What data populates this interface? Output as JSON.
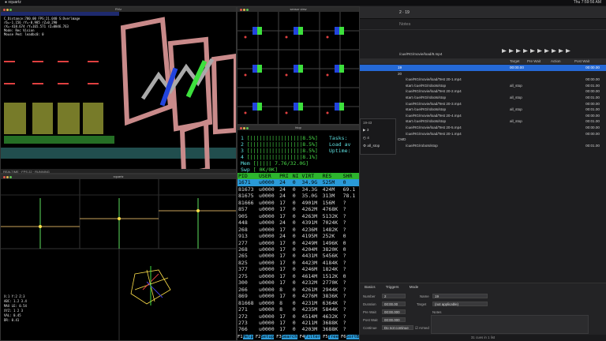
{
  "menubar": {
    "app": "xquartz",
    "clock": "Thu 7:59:56 AM"
  },
  "windows": {
    "topleft_title": "RViz",
    "topmid_title": "rviz_sim",
    "sensor_title": "sensor view",
    "bottomleft_title": "xquartz",
    "bottomleft_sub": "rviz",
    "htop_title": "htop"
  },
  "topleft_text": {
    "lines": [
      "C_Distance:780.00 FPS:21.040 S:Overlmage",
      "rb=-1.156 rY=-0.985 rZ=0.290",
      "rX=-418.674 rY=165.571 rZ=0846.763",
      "Mode: Rec Vision",
      "Mouse Ped: leadbc0: 0"
    ]
  },
  "htop": {
    "meters": [
      {
        "id": "1",
        "bar": "[|||||||||||||||||8.5%]",
        "right_label": "Tasks:"
      },
      {
        "id": "2",
        "bar": "[|||||||||||||||||8.5%]",
        "right_label": "Load av"
      },
      {
        "id": "3",
        "bar": "[|||||||||||||||||8.5%]",
        "right_label": "Uptime:"
      },
      {
        "id": "4",
        "bar": "[|||||||||||||||||8.1%]",
        "right_label": ""
      },
      {
        "id": "Mem",
        "bar": "[||||| 7.76/32.0G]",
        "right_label": ""
      },
      {
        "id": "Swp",
        "bar": "[ 0K/0K]",
        "right_label": ""
      }
    ],
    "columns": [
      "PID",
      "USER",
      "PRI",
      "NI",
      "VIRT",
      "RES",
      "SHR"
    ],
    "rows": [
      {
        "pid": "1671",
        "user": "u0000",
        "pri": "24",
        "ni": "0",
        "virt": "34.9G",
        "res": "525M",
        "shr": "0"
      },
      {
        "pid": "81673",
        "user": "u0000",
        "pri": "24",
        "ni": "0",
        "virt": "34.3G",
        "res": "424M",
        "shr": "69.1"
      },
      {
        "pid": "81675",
        "user": "u0000",
        "pri": "24",
        "ni": "0",
        "virt": "35.0G",
        "res": "313M",
        "shr": "78.1"
      },
      {
        "pid": "81666",
        "user": "u0000",
        "pri": "17",
        "ni": "0",
        "virt": "4901M",
        "res": "156M",
        "shr": "?"
      },
      {
        "pid": "857",
        "user": "u0000",
        "pri": "17",
        "ni": "0",
        "virt": "4262M",
        "res": "4768K",
        "shr": "?"
      },
      {
        "pid": "905",
        "user": "u0000",
        "pri": "17",
        "ni": "0",
        "virt": "4263M",
        "res": "5132K",
        "shr": "?"
      },
      {
        "pid": "448",
        "user": "u0000",
        "pri": "24",
        "ni": "0",
        "virt": "4391M",
        "res": "7024K",
        "shr": "?"
      },
      {
        "pid": "268",
        "user": "u0000",
        "pri": "17",
        "ni": "0",
        "virt": "4236M",
        "res": "1482K",
        "shr": "?"
      },
      {
        "pid": "913",
        "user": "u0000",
        "pri": "24",
        "ni": "0",
        "virt": "4195M",
        "res": "252K",
        "shr": "0"
      },
      {
        "pid": "277",
        "user": "u0000",
        "pri": "17",
        "ni": "0",
        "virt": "4249M",
        "res": "1496K",
        "shr": "0"
      },
      {
        "pid": "268",
        "user": "u0000",
        "pri": "17",
        "ni": "0",
        "virt": "4204M",
        "res": "3820K",
        "shr": "0"
      },
      {
        "pid": "265",
        "user": "u0000",
        "pri": "17",
        "ni": "0",
        "virt": "4431M",
        "res": "5456K",
        "shr": "?"
      },
      {
        "pid": "825",
        "user": "u0000",
        "pri": "17",
        "ni": "0",
        "virt": "4423M",
        "res": "4184K",
        "shr": "?"
      },
      {
        "pid": "377",
        "user": "u0000",
        "pri": "17",
        "ni": "0",
        "virt": "4246M",
        "res": "1824K",
        "shr": "?"
      },
      {
        "pid": "275",
        "user": "u0000",
        "pri": "17",
        "ni": "0",
        "virt": "4614M",
        "res": "1512K",
        "shr": "0"
      },
      {
        "pid": "300",
        "user": "u0000",
        "pri": "17",
        "ni": "0",
        "virt": "4232M",
        "res": "2770K",
        "shr": "?"
      },
      {
        "pid": "266",
        "user": "u0000",
        "pri": "8",
        "ni": "0",
        "virt": "4261M",
        "res": "2944K",
        "shr": "?"
      },
      {
        "pid": "869",
        "user": "u0000",
        "pri": "17",
        "ni": "0",
        "virt": "4276M",
        "res": "3836K",
        "shr": "?"
      },
      {
        "pid": "81668",
        "user": "u0000",
        "pri": "8",
        "ni": "0",
        "virt": "4231M",
        "res": "6364K",
        "shr": "?"
      },
      {
        "pid": "271",
        "user": "u0000",
        "pri": "8",
        "ni": "0",
        "virt": "4235M",
        "res": "5844K",
        "shr": "?"
      },
      {
        "pid": "272",
        "user": "u0000",
        "pri": "17",
        "ni": "0",
        "virt": "4514M",
        "res": "4632K",
        "shr": "?"
      },
      {
        "pid": "273",
        "user": "u0000",
        "pri": "17",
        "ni": "0",
        "virt": "4211M",
        "res": "3688K",
        "shr": "?"
      },
      {
        "pid": "766",
        "user": "u0000",
        "pri": "17",
        "ni": "0",
        "virt": "4203M",
        "res": "3688K",
        "shr": "?"
      },
      {
        "pid": "301",
        "user": "u0000",
        "pri": "24",
        "ni": "0",
        "virt": "4448M",
        "res": "5420K",
        "shr": "?"
      }
    ],
    "fkeys": [
      {
        "k": "F1",
        "v": "Help"
      },
      {
        "k": "F2",
        "v": "Setup"
      },
      {
        "k": "F3",
        "v": "Search"
      },
      {
        "k": "F4",
        "v": "Filter"
      },
      {
        "k": "F5",
        "v": "Tree"
      },
      {
        "k": "F6",
        "v": "SortBy"
      }
    ]
  },
  "app": {
    "title": "2 · 19",
    "notes_placeholder": "Notes",
    "header": {
      "target": "Target",
      "pre_wait": "Pre Wait",
      "action": "Action",
      "post_wait": "Post Wait"
    },
    "top_path": "/cue/RG/movie/load/8.mp4",
    "rows": [
      {
        "label": "19",
        "t1": "00:00.00",
        "t2": "00:00.00",
        "sel": true,
        "indent": 0
      },
      {
        "label": "20",
        "t1": "",
        "t2": "",
        "sel": false,
        "indent": 0
      },
      {
        "label": "/cue/RG/movie/load/Test 20-1.mp4",
        "t1": "",
        "t2": "00:00.00",
        "sel": false,
        "indent": 1
      },
      {
        "label": "start /cue/RG/robots/stop",
        "t1": "all_stop",
        "t2": "00:01.00",
        "sel": false,
        "indent": 1
      },
      {
        "label": "/cue/RG/movie/load/Test 20-2.mp4",
        "t1": "",
        "t2": "00:00.00",
        "sel": false,
        "indent": 1
      },
      {
        "label": "start /cue/RG/robots/stop",
        "t1": "all_stop",
        "t2": "00:01.00",
        "sel": false,
        "indent": 1
      },
      {
        "label": "/cue/RG/movie/load/Test 20-3.mp4",
        "t1": "",
        "t2": "00:00.00",
        "sel": false,
        "indent": 1
      },
      {
        "label": "start /cue/RG/robots/stop",
        "t1": "all_stop",
        "t2": "00:01.00",
        "sel": false,
        "indent": 1
      },
      {
        "label": "/cue/RG/movie/load/Test 20-4.mp4",
        "t1": "",
        "t2": "00:00.00",
        "sel": false,
        "indent": 1
      },
      {
        "label": "start /cue/RG/robots/stop",
        "t1": "all_stop",
        "t2": "00:01.00",
        "sel": false,
        "indent": 1
      },
      {
        "label": "/cue/RG/movie/load/Test 20-5.mp4",
        "t1": "",
        "t2": "00:00.00",
        "sel": false,
        "indent": 1
      },
      {
        "label": "/cue/RG/movie/load/Test 20-1.mp4",
        "t1": "",
        "t2": "00:00.00",
        "sel": false,
        "indent": 1
      },
      {
        "label": "CMD",
        "t1": "",
        "t2": "",
        "sel": false,
        "indent": 0
      },
      {
        "label": "/cue/RG/robots/stop",
        "t1": "",
        "t2": "00:01.00",
        "sel": false,
        "indent": 1
      }
    ],
    "popup": {
      "items": [
        "3",
        "4",
        "all_stop"
      ],
      "header": "19-43"
    },
    "inspector": {
      "tabs": [
        "Basics",
        "Triggers",
        "Mode"
      ],
      "number_label": "Number",
      "number_value": "2",
      "name_label": "Name",
      "name_value": "19",
      "duration_label": "Duration",
      "duration_value": "00:00.00",
      "target_label": "Target",
      "target_value": "(not applicable)",
      "prewait_label": "Pre Wait",
      "prewait_value": "00:00.000",
      "postwait_label": "Post Wait",
      "postwait_value": "00:00.000",
      "continue_label": "Continue",
      "continue_value": "Do not continue",
      "notes_label": "Notes",
      "armed_label": "Armed"
    },
    "footer": "31 cues in 1 list"
  }
}
